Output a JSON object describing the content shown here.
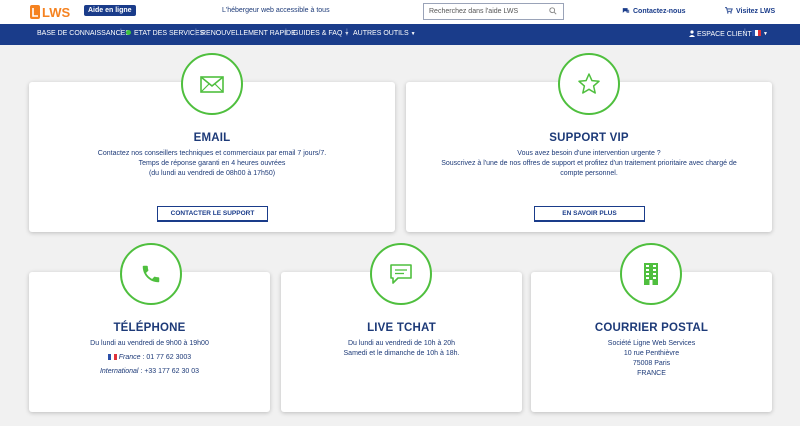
{
  "header": {
    "logo_text": "LWS",
    "badge": "Aide en ligne",
    "tagline": "L'hébergeur web accessible à tous",
    "search_placeholder": "Recherchez dans l'aide LWS",
    "contact_link": "Contactez-nous",
    "visit_link": "Visitez LWS"
  },
  "nav": {
    "items": [
      "BASE DE CONNAISSANCES",
      "ETAT DES SERVICES",
      "RENOUVELLEMENT RAPIDE",
      "GUIDES & FAQ",
      "AUTRES OUTILS"
    ],
    "client": "ESPACE CLIENT"
  },
  "colors": {
    "primary": "#1a3c8a",
    "accent": "#4fbf3e",
    "background": "#f1f1f1"
  },
  "cards": {
    "email": {
      "icon": "envelope-icon",
      "title": "EMAIL",
      "line1": "Contactez nos conseillers techniques et commerciaux par email 7 jours/7.",
      "line2": "Temps de réponse garanti en 4 heures ouvrées",
      "line3": "(du lundi au vendredi de 08h00 à 17h50)",
      "button": "CONTACTER LE SUPPORT"
    },
    "vip": {
      "icon": "star-icon",
      "title": "SUPPORT VIP",
      "line1": "Vous avez besoin d'une intervention urgente ?",
      "line2": "Souscrivez à l'une de nos offres de support et profitez d'un traitement prioritaire avec chargé de",
      "line3": "compte personnel.",
      "button": "EN SAVOIR PLUS"
    },
    "phone": {
      "icon": "phone-icon",
      "title": "TÉLÉPHONE",
      "hours": "Du lundi au vendredi de 9h00 à 19h00",
      "france_label": "France",
      "france_number": ": 01 77 62 3003",
      "intl_label": "International",
      "intl_number": ": +33 177 62 30 03"
    },
    "chat": {
      "icon": "chat-icon",
      "title": "LIVE TCHAT",
      "line1": "Du lundi au vendredi de 10h à 20h",
      "line2": "Samedi et le dimanche de 10h à 18h."
    },
    "mail": {
      "icon": "building-icon",
      "title": "COURRIER POSTAL",
      "line1": "Société Ligne Web Services",
      "line2": "10 rue Penthièvre",
      "line3": "75008 Paris",
      "line4": "FRANCE"
    }
  }
}
